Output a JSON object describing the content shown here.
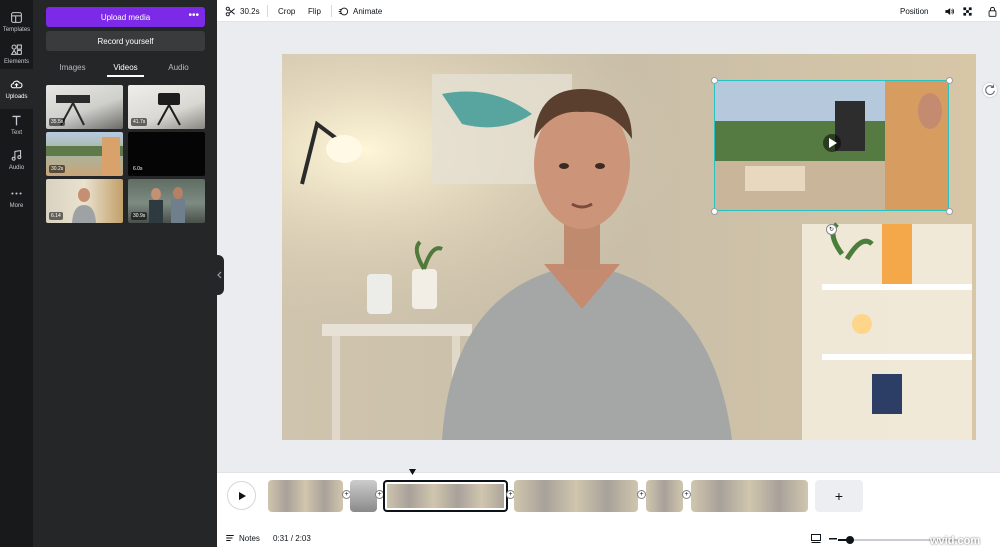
{
  "rail": {
    "items": [
      {
        "label": "Templates"
      },
      {
        "label": "Elements"
      },
      {
        "label": "Uploads"
      },
      {
        "label": "Text"
      },
      {
        "label": "Audio"
      },
      {
        "label": "More"
      }
    ]
  },
  "panel": {
    "upload_label": "Upload media",
    "more_glyph": "•••",
    "record_label": "Record yourself",
    "tabs": [
      {
        "label": "Images"
      },
      {
        "label": "Videos"
      },
      {
        "label": "Audio"
      }
    ],
    "active_tab": "Videos",
    "thumbnails": [
      {
        "duration": "35.5s"
      },
      {
        "duration": "41.7s"
      },
      {
        "duration": "30.2s"
      },
      {
        "duration": "6.0s"
      },
      {
        "duration": "6.14"
      },
      {
        "duration": "30.9s"
      }
    ]
  },
  "toolbar": {
    "duration": "30.2s",
    "crop": "Crop",
    "flip": "Flip",
    "animate": "Animate",
    "position": "Position"
  },
  "canvas": {
    "rotate_badge": "↻"
  },
  "timeline": {
    "add_glyph": "+",
    "add_clip_glyph": "+"
  },
  "bottom": {
    "notes": "Notes",
    "time": "0:31 / 2:03",
    "zoom_fraction": 0.1
  },
  "watermark": "wvid.com",
  "colors": {
    "accent": "#7d2ae8",
    "selection": "#28c3c0",
    "rail_bg": "#18191b",
    "panel_bg": "#252627"
  }
}
